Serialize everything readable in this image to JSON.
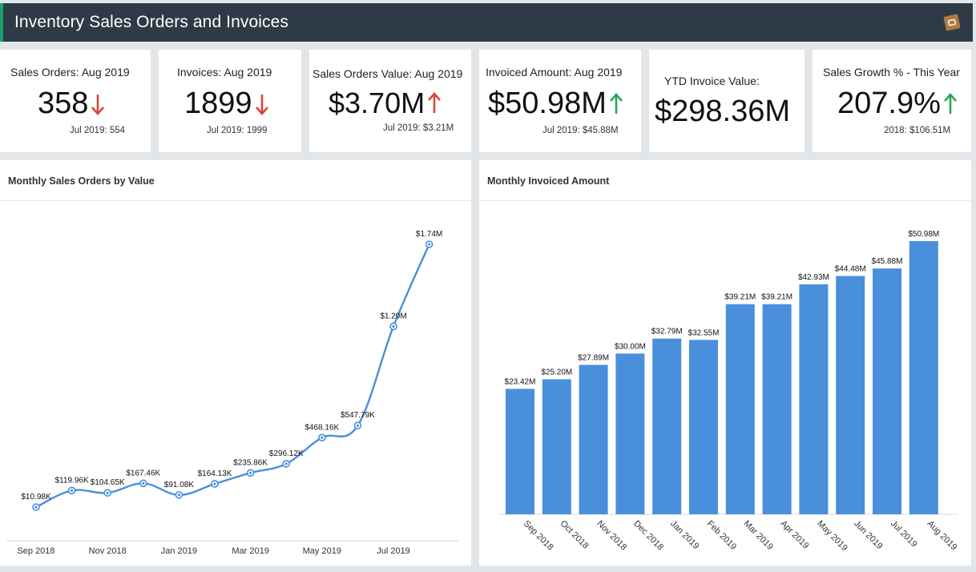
{
  "header": {
    "title": "Inventory Sales Orders and Invoices",
    "icon": "box-icon"
  },
  "kpis": [
    {
      "label": "Sales Orders: Aug 2019",
      "value": "358",
      "trend": "down",
      "sub": "Jul 2019: 554"
    },
    {
      "label": "Invoices: Aug 2019",
      "value": "1899",
      "trend": "down",
      "sub": "Jul 2019: 1999"
    },
    {
      "label": "Sales Orders Value: Aug 2019",
      "value": "$3.70M",
      "trend": "up",
      "sub": "Jul 2019: $3.21M"
    },
    {
      "label": "Invoiced Amount: Aug 2019",
      "value": "$50.98M",
      "trend": "up",
      "sub": "Jul 2019: $45.88M"
    },
    {
      "label": "YTD Invoice Value:",
      "value": "$298.36M",
      "trend": "none",
      "sub": ""
    },
    {
      "label": "Sales Growth % - This Year",
      "value": "207.9%",
      "trend": "up",
      "sub": "2018: $106.51M"
    }
  ],
  "colors": {
    "header_bg": "#2e3b47",
    "header_accent": "#1aa06d",
    "down_arrow": "#d9463b",
    "up_arrow": "#2fa35a",
    "line_series": "#4a8fdb",
    "bar_series": "#4a8fdb"
  },
  "chart_data": [
    {
      "type": "line",
      "title": "Monthly Sales Orders by Value",
      "categories": [
        "Sep 2018",
        "Oct 2018",
        "Nov 2018",
        "Dec 2018",
        "Jan 2019",
        "Feb 2019",
        "Mar 2019",
        "Apr 2019",
        "May 2019",
        "Jun 2019",
        "Jul 2019",
        "Aug 2019"
      ],
      "values": [
        10980,
        119960,
        104650,
        167460,
        91080,
        164130,
        235860,
        296120,
        468160,
        547790,
        1200000,
        1740000
      ],
      "data_labels": [
        "$10.98K",
        "$119.96K",
        "$104.65K",
        "$167.46K",
        "$91.08K",
        "$164.13K",
        "$235.86K",
        "$296.12K",
        "$468.16K",
        "$547.79K",
        "$1.20M",
        "$1.74M"
      ],
      "x_tick_labels": [
        "Sep 2018",
        "Nov 2018",
        "Jan 2019",
        "Mar 2019",
        "May 2019",
        "Jul 2019"
      ],
      "ylim": [
        0,
        1900000
      ],
      "grid": false
    },
    {
      "type": "bar",
      "title": "Monthly Invoiced Amount",
      "categories": [
        "Sep 2018",
        "Oct 2018",
        "Nov 2018",
        "Dec 2018",
        "Jan 2019",
        "Feb 2019",
        "Mar 2019",
        "Apr 2019",
        "May 2019",
        "Jun 2019",
        "Jul 2019",
        "Aug 2019"
      ],
      "values": [
        23.42,
        25.2,
        27.89,
        30.0,
        32.79,
        32.55,
        39.21,
        39.21,
        42.93,
        44.48,
        45.88,
        50.98
      ],
      "data_labels": [
        "$23.42M",
        "$25.20M",
        "$27.89M",
        "$30.00M",
        "$32.79M",
        "$32.55M",
        "$39.21M",
        "$39.21M",
        "$42.93M",
        "$44.48M",
        "$45.88M",
        "$50.98M"
      ],
      "ylim": [
        0,
        55
      ],
      "grid": false
    }
  ]
}
